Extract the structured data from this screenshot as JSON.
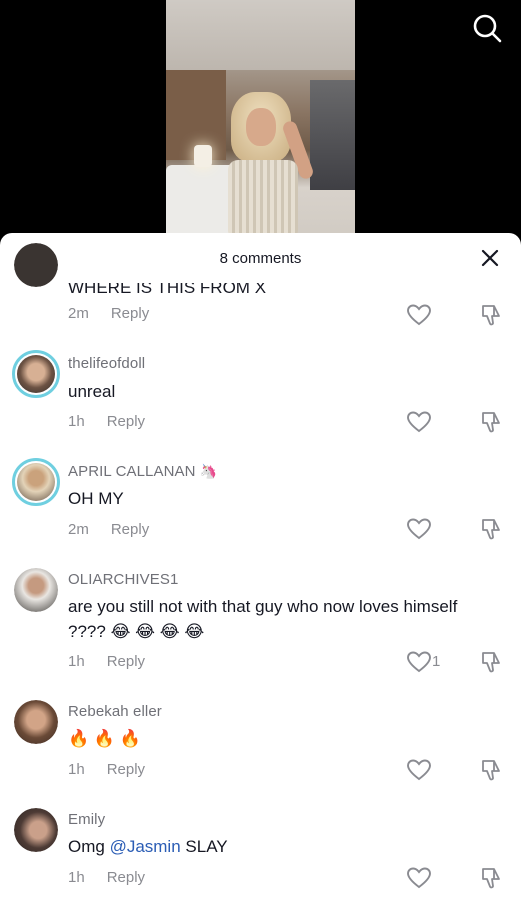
{
  "sheet": {
    "title": "8 comments"
  },
  "icons": {
    "search": "search-icon",
    "close": "close-icon",
    "like": "heart-outline-icon",
    "dislike": "thumbs-down-icon"
  },
  "colors": {
    "ring": "#6fcfe0",
    "mention": "#2b5db5",
    "muted": "#8a8b91",
    "text": "#161823"
  },
  "comments": [
    {
      "username": "",
      "text": "WHERE IS THIS FROM X",
      "time": "2m",
      "reply_label": "Reply",
      "likes": ""
    },
    {
      "username": "thelifeofdoll",
      "text": "unreal",
      "time": "1h",
      "reply_label": "Reply",
      "likes": ""
    },
    {
      "username": "APRIL CALLANAN",
      "text": "OH MY",
      "time": "2m",
      "reply_label": "Reply",
      "likes": "",
      "badge": "🦄"
    },
    {
      "username": "OLIARCHIVES1",
      "text": "are you still not with that guy who now loves himself ????",
      "time": "1h",
      "reply_label": "Reply",
      "likes": "1",
      "emoji": "😂 😂 😂 😂"
    },
    {
      "username": "Rebekah eller",
      "text": "",
      "time": "1h",
      "reply_label": "Reply",
      "likes": "",
      "emoji": "🔥 🔥 🔥"
    },
    {
      "username": "Emily",
      "text_before": "Omg ",
      "mention": "@Jasmin",
      "text_after": " SLAY",
      "time": "1h",
      "reply_label": "Reply",
      "likes": ""
    }
  ]
}
